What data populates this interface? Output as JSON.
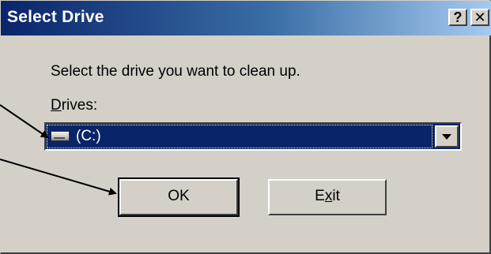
{
  "window": {
    "title": "Select Drive",
    "help_label": "?",
    "close_label": "✕"
  },
  "instruction": "Select the drive you want to clean up.",
  "drives": {
    "label_mnemonic": "D",
    "label_rest": "rives:",
    "selected_value": "(C:)"
  },
  "buttons": {
    "ok_label": "OK",
    "exit_prefix": "E",
    "exit_mnemonic": "x",
    "exit_suffix": "it"
  },
  "icons": [
    "help-icon",
    "close-icon",
    "hard-drive-icon",
    "dropdown-arrow-icon"
  ],
  "colors": {
    "titlebar_start": "#0a246a",
    "titlebar_end": "#a6caf0",
    "selection": "#0a246a",
    "dialog_face": "#d4d0c8"
  }
}
